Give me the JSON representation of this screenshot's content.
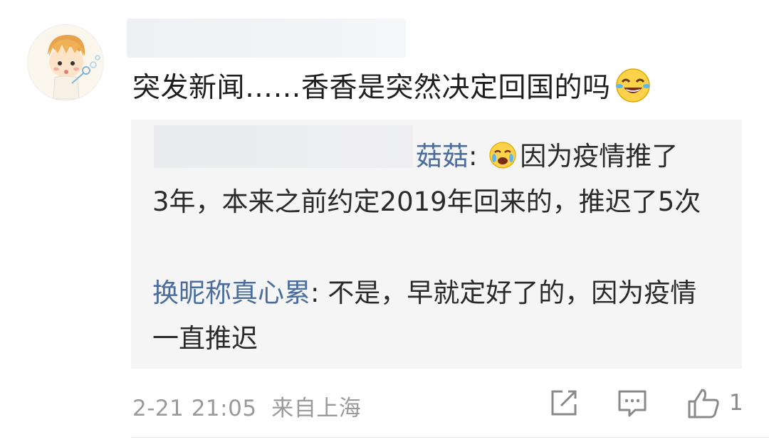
{
  "comment": {
    "text": "突发新闻……香香是突然决定回国的吗",
    "emoji": "laughing-tears-emoji"
  },
  "replies": [
    {
      "author": "菇菇",
      "separator": ": ",
      "emoji": "crying-laughing-emoji",
      "text_first_line": "因为疫情推了",
      "text_rest": "3年，本来之前约定2019年回来的，推迟了5次"
    },
    {
      "author": "换昵称真心累",
      "separator": ": ",
      "text": "不是，早就定好了的，因为疫情一直推迟"
    }
  ],
  "meta": {
    "timestamp": "2-21 21:05",
    "location": "来自上海"
  },
  "actions": {
    "share_icon": "share-icon",
    "reply_icon": "comment-icon",
    "like_icon": "thumbs-up-icon",
    "like_count": "1"
  },
  "colors": {
    "author": "#4a6d9c",
    "meta": "#9a9a9a",
    "reply_bg": "#f5f5f5"
  }
}
